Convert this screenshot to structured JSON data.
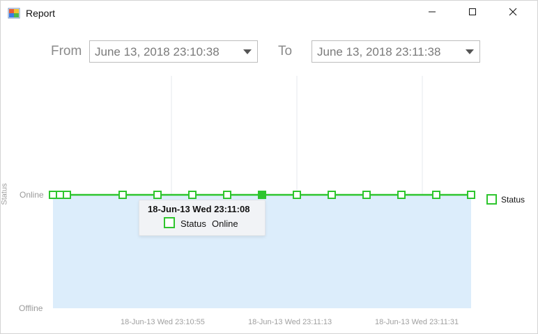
{
  "window": {
    "title": "Report",
    "icon": "report-app-icon",
    "controls": [
      "minimize-icon",
      "maximize-icon",
      "close-icon"
    ]
  },
  "range": {
    "from_label": "From",
    "from_value": "June 13, 2018 23:10:38",
    "to_label": "To",
    "to_value": "June 13, 2018 23:11:38"
  },
  "chart_data": {
    "type": "area",
    "ylabel": "Status",
    "y_categories": [
      "Offline",
      "Online"
    ],
    "x_tick_labels": [
      "18-Jun-13 Wed 23:10:55",
      "18-Jun-13 Wed 23:11:13",
      "18-Jun-13 Wed 23:11:31"
    ],
    "series": [
      {
        "name": "Status",
        "color": "#2ec52e",
        "fill": "#dcedfb",
        "points": [
          {
            "x": "23:10:38",
            "y": "Online"
          },
          {
            "x": "23:10:39",
            "y": "Online"
          },
          {
            "x": "23:10:40",
            "y": "Online"
          },
          {
            "x": "23:10:48",
            "y": "Online"
          },
          {
            "x": "23:10:53",
            "y": "Online"
          },
          {
            "x": "23:10:58",
            "y": "Online"
          },
          {
            "x": "23:11:03",
            "y": "Online"
          },
          {
            "x": "23:11:08",
            "y": "Online"
          },
          {
            "x": "23:11:13",
            "y": "Online"
          },
          {
            "x": "23:11:18",
            "y": "Online"
          },
          {
            "x": "23:11:23",
            "y": "Online"
          },
          {
            "x": "23:11:28",
            "y": "Online"
          },
          {
            "x": "23:11:33",
            "y": "Online"
          },
          {
            "x": "23:11:38",
            "y": "Online"
          }
        ]
      }
    ],
    "legend": "right",
    "highlighted_point": "23:11:08",
    "tooltip": {
      "title": "18-Jun-13 Wed 23:11:08",
      "series": "Status",
      "value": "Online"
    }
  }
}
